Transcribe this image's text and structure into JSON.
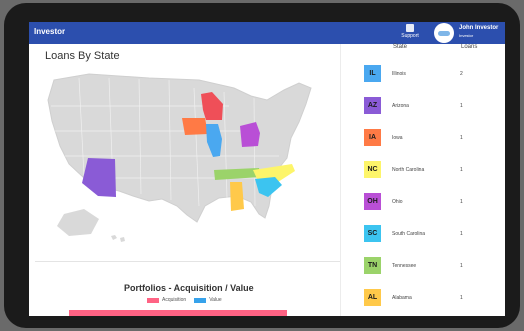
{
  "header": {
    "brand": "Investor",
    "support_label": "Support",
    "user_name": "John Investor",
    "user_role": "Investor"
  },
  "map_panel": {
    "title": "Loans By State"
  },
  "table": {
    "col_state": "State",
    "col_loans": "Loans",
    "rows": [
      {
        "abbr": "IL",
        "name": "Illinois",
        "loans": "2",
        "color": "#4aa8f0"
      },
      {
        "abbr": "AZ",
        "name": "Arizona",
        "loans": "1",
        "color": "#8a5bd6"
      },
      {
        "abbr": "IA",
        "name": "Iowa",
        "loans": "1",
        "color": "#ff7a45"
      },
      {
        "abbr": "NC",
        "name": "North Carolina",
        "loans": "1",
        "color": "#fdf56a"
      },
      {
        "abbr": "OH",
        "name": "Ohio",
        "loans": "1",
        "color": "#b94fd6"
      },
      {
        "abbr": "SC",
        "name": "South Carolina",
        "loans": "1",
        "color": "#3cc4f0"
      },
      {
        "abbr": "TN",
        "name": "Tennessee",
        "loans": "1",
        "color": "#9bd36a"
      },
      {
        "abbr": "AL",
        "name": "Alabama",
        "loans": "1",
        "color": "#ffc94a"
      }
    ]
  },
  "chart": {
    "title": "Portfolios - Acquisition / Value",
    "legend": [
      {
        "label": "Acquisition",
        "color": "#ff6384"
      },
      {
        "label": "Value",
        "color": "#36a2eb"
      }
    ]
  },
  "icons": {
    "support": "support-icon",
    "logo": "company-logo"
  }
}
